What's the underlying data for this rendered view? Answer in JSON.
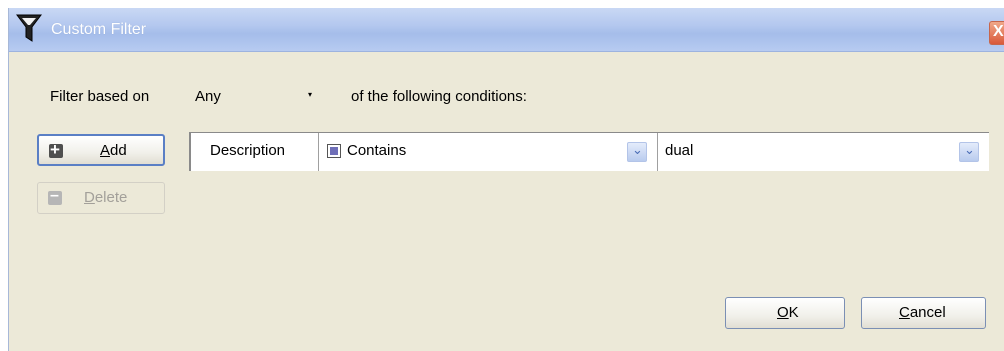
{
  "window": {
    "title": "Custom Filter",
    "close_glyph": "X"
  },
  "filter": {
    "prefix_label": "Filter based on",
    "match_value": "Any",
    "match_arrow": "▾",
    "suffix_label": "of the following conditions:"
  },
  "buttons": {
    "add": {
      "accel": "A",
      "rest": "dd",
      "icon": "plus-icon"
    },
    "delete": {
      "accel": "D",
      "rest": "elete",
      "icon": "minus-icon"
    },
    "ok": {
      "accel": "O",
      "rest": "K"
    },
    "cancel": {
      "accel": "C",
      "rest": "ancel"
    }
  },
  "condition": {
    "field": "Description",
    "operator": "Contains",
    "value": "dual",
    "dropdown_glyph": "⌄"
  },
  "colors": {
    "titlebar": "#b4c8ef",
    "dialog_bg": "#ece9d8",
    "focus_border": "#5a7fc5",
    "close_button": "#d9593a"
  }
}
